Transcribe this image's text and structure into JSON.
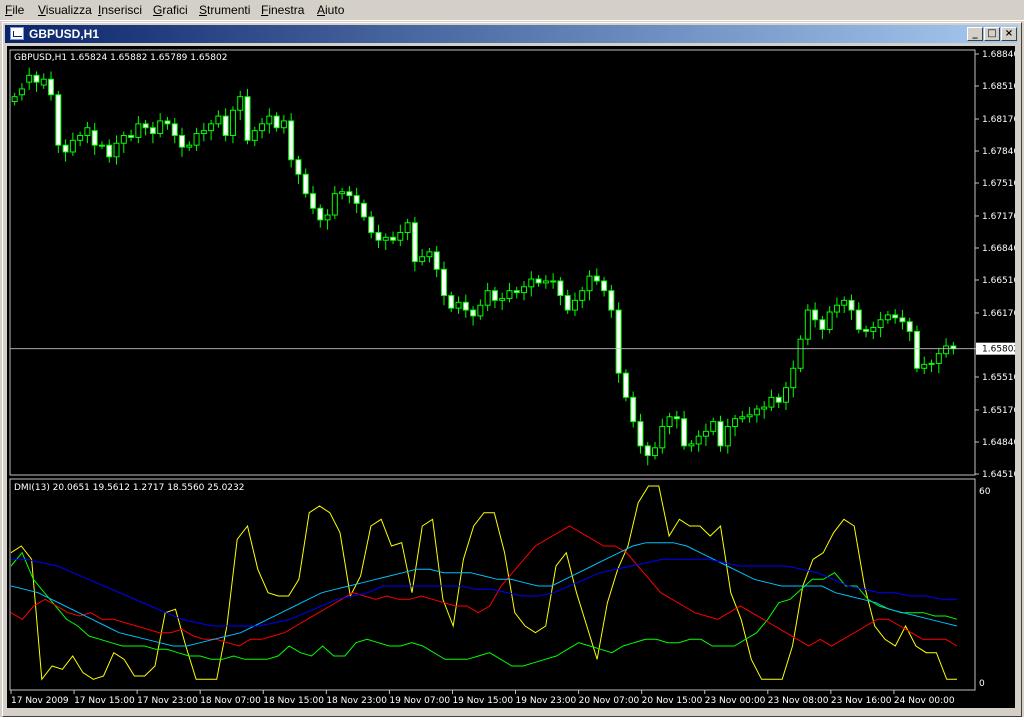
{
  "menu": {
    "items": [
      {
        "underline": "F",
        "rest": "ile"
      },
      {
        "underline": "V",
        "rest": "isualizza"
      },
      {
        "underline": "I",
        "rest": "nserisci"
      },
      {
        "underline": "G",
        "rest": "rafici"
      },
      {
        "underline": "S",
        "rest": "trumenti"
      },
      {
        "underline": "F",
        "rest": "inestra"
      },
      {
        "underline": "A",
        "rest": "iuto"
      }
    ]
  },
  "window": {
    "title": "GBPUSD,H1",
    "buttons": [
      "_",
      "□",
      "×"
    ]
  },
  "chart_data": [
    {
      "type": "candlestick",
      "title": "GBPUSD,H1  1.65824 1.65882 1.65789 1.65802",
      "ylim": [
        1.6451,
        1.6884
      ],
      "y_ticks": [
        "1.68840",
        "1.68510",
        "1.68170",
        "1.67840",
        "1.67510",
        "1.67170",
        "1.66840",
        "1.66510",
        "1.66170",
        "1.65802",
        "1.65510",
        "1.65170",
        "1.64840",
        "1.64510"
      ],
      "current_price": 1.65802,
      "colors": {
        "up": "#000000",
        "down": "#ffffff",
        "wick": "#00ff00",
        "price_line": "#c0c0c0"
      },
      "closes": [
        1.684,
        1.6848,
        1.6862,
        1.6855,
        1.6858,
        1.6842,
        1.679,
        1.6783,
        1.6795,
        1.68,
        1.6808,
        1.679,
        1.679,
        1.6778,
        1.6792,
        1.68,
        1.6798,
        1.6812,
        1.6808,
        1.6802,
        1.6815,
        1.6812,
        1.68,
        1.6788,
        1.679,
        1.6802,
        1.6805,
        1.6812,
        1.682,
        1.68,
        1.6826,
        1.684,
        1.6795,
        1.6805,
        1.6812,
        1.682,
        1.6808,
        1.6815,
        1.6775,
        1.676,
        1.674,
        1.6725,
        1.6713,
        1.6718,
        1.674,
        1.6742,
        1.6738,
        1.673,
        1.6716,
        1.67,
        1.6692,
        1.6695,
        1.6692,
        1.67,
        1.671,
        1.667,
        1.6675,
        1.668,
        1.6662,
        1.6635,
        1.6622,
        1.6628,
        1.662,
        1.6614,
        1.6625,
        1.664,
        1.663,
        1.6632,
        1.664,
        1.6638,
        1.6644,
        1.6652,
        1.6648,
        1.665,
        1.665,
        1.6635,
        1.662,
        1.663,
        1.664,
        1.6655,
        1.665,
        1.664,
        1.662,
        1.6555,
        1.653,
        1.6505,
        1.648,
        1.647,
        1.6478,
        1.65,
        1.651,
        1.6508,
        1.648,
        1.6482,
        1.649,
        1.6495,
        1.6505,
        1.648,
        1.65,
        1.6508,
        1.651,
        1.6512,
        1.6518,
        1.652,
        1.653,
        1.6525,
        1.654,
        1.656,
        1.659,
        1.662,
        1.661,
        1.66,
        1.6618,
        1.6625,
        1.663,
        1.662,
        1.66,
        1.6598,
        1.6602,
        1.661,
        1.6615,
        1.6612,
        1.6608,
        1.6598,
        1.656,
        1.6564,
        1.6565,
        1.6575,
        1.6583,
        1.65802
      ],
      "opens": [
        1.6835,
        1.6842,
        1.6855,
        1.6862,
        1.6852,
        1.6858,
        1.6842,
        1.679,
        1.6783,
        1.6795,
        1.68,
        1.6805,
        1.679,
        1.679,
        1.6778,
        1.6792,
        1.68,
        1.6798,
        1.6812,
        1.6808,
        1.6802,
        1.6815,
        1.6812,
        1.68,
        1.6788,
        1.679,
        1.6802,
        1.6805,
        1.6812,
        1.682,
        1.68,
        1.6826,
        1.684,
        1.6795,
        1.6805,
        1.6812,
        1.682,
        1.6808,
        1.6815,
        1.6775,
        1.676,
        1.674,
        1.6725,
        1.6713,
        1.6718,
        1.674,
        1.6742,
        1.6738,
        1.673,
        1.6716,
        1.67,
        1.6692,
        1.6695,
        1.6692,
        1.67,
        1.671,
        1.667,
        1.6675,
        1.668,
        1.6662,
        1.6635,
        1.6622,
        1.6628,
        1.662,
        1.6614,
        1.6625,
        1.664,
        1.663,
        1.6632,
        1.664,
        1.6638,
        1.6644,
        1.6652,
        1.6648,
        1.665,
        1.665,
        1.6635,
        1.662,
        1.663,
        1.664,
        1.6655,
        1.665,
        1.664,
        1.662,
        1.6555,
        1.653,
        1.6505,
        1.648,
        1.647,
        1.6478,
        1.65,
        1.651,
        1.6508,
        1.648,
        1.6482,
        1.649,
        1.6495,
        1.6505,
        1.648,
        1.65,
        1.6508,
        1.651,
        1.6512,
        1.6518,
        1.652,
        1.653,
        1.6525,
        1.654,
        1.656,
        1.659,
        1.662,
        1.661,
        1.66,
        1.6618,
        1.6625,
        1.663,
        1.662,
        1.66,
        1.6598,
        1.6602,
        1.661,
        1.6615,
        1.6612,
        1.6608,
        1.6598,
        1.656,
        1.6564,
        1.6565,
        1.6575,
        1.6583
      ]
    },
    {
      "type": "line",
      "title": "DMI(13) 20.0651 19.5612 1.2717 18.5560 25.0232",
      "ylim": [
        0,
        60
      ],
      "y_ticks": [
        "60",
        "0"
      ],
      "x_labels": [
        "17 Nov 2009",
        "17 Nov 15:00",
        "17 Nov 23:00",
        "18 Nov 07:00",
        "18 Nov 15:00",
        "18 Nov 23:00",
        "19 Nov 07:00",
        "19 Nov 15:00",
        "19 Nov 23:00",
        "20 Nov 07:00",
        "20 Nov 15:00",
        "23 Nov 00:00",
        "23 Nov 08:00",
        "23 Nov 16:00",
        "24 Nov 00:00"
      ],
      "series": [
        {
          "color": "#ffff00",
          "values": [
            40,
            42,
            38,
            2,
            6,
            5,
            9,
            4,
            2,
            3,
            10,
            8,
            3,
            3,
            6,
            22,
            23,
            12,
            2,
            2,
            2,
            18,
            44,
            48,
            35,
            28,
            27,
            27,
            32,
            52,
            54,
            52,
            46,
            27,
            33,
            48,
            50,
            42,
            43,
            28,
            48,
            50,
            26,
            18,
            38,
            48,
            52,
            52,
            40,
            22,
            18,
            16,
            18,
            36,
            40,
            28,
            18,
            8,
            25,
            35,
            42,
            55,
            60,
            60,
            45,
            50,
            48,
            48,
            45,
            48,
            28,
            20,
            8,
            2,
            2,
            2,
            12,
            30,
            38,
            40,
            46,
            50,
            48,
            30,
            18,
            14,
            12,
            18,
            12,
            10,
            10,
            2,
            2
          ]
        },
        {
          "color": "#00ff00",
          "values": [
            36,
            40,
            32,
            28,
            24,
            20,
            18,
            15,
            14,
            13,
            12,
            12,
            12,
            11,
            11,
            10,
            9,
            9,
            8,
            8,
            9,
            8,
            8,
            8,
            9,
            12,
            10,
            9,
            12,
            9,
            9,
            13,
            14,
            13,
            12,
            12,
            13,
            12,
            10,
            8,
            8,
            8,
            9,
            10,
            8,
            6,
            6,
            7,
            8,
            9,
            11,
            13,
            12,
            11,
            10,
            12,
            13,
            14,
            14,
            13,
            13,
            14,
            14,
            12,
            12,
            12,
            14,
            16,
            20,
            25,
            26,
            29,
            32,
            32,
            34,
            30,
            30,
            26,
            24,
            23,
            22,
            22,
            22,
            21,
            21,
            20
          ]
        },
        {
          "color": "#ff0000",
          "values": [
            22,
            20,
            24,
            26,
            24,
            22,
            21,
            22,
            20,
            20,
            19,
            18,
            17,
            16,
            16,
            17,
            15,
            14,
            14,
            13,
            12,
            14,
            14,
            15,
            16,
            18,
            20,
            22,
            24,
            26,
            28,
            27,
            26,
            27,
            26,
            26,
            27,
            26,
            25,
            24,
            24,
            22,
            24,
            30,
            34,
            38,
            42,
            44,
            46,
            48,
            46,
            44,
            42,
            42,
            40,
            36,
            32,
            28,
            26,
            24,
            22,
            21,
            20,
            22,
            24,
            22,
            20,
            18,
            16,
            14,
            12,
            14,
            12,
            14,
            16,
            18,
            20,
            20,
            18,
            16,
            14,
            14,
            14,
            12
          ]
        },
        {
          "color": "#00bfff",
          "values": [
            30,
            29,
            28,
            26,
            24,
            22,
            20,
            18,
            16,
            15,
            14,
            13,
            12,
            12,
            13,
            14,
            15,
            16,
            18,
            20,
            22,
            24,
            26,
            28,
            29,
            30,
            31,
            32,
            33,
            34,
            35,
            35,
            34,
            34,
            34,
            33,
            32,
            32,
            31,
            30,
            30,
            32,
            34,
            36,
            38,
            40,
            42,
            43,
            43,
            43,
            42,
            40,
            38,
            36,
            34,
            32,
            31,
            30,
            30,
            30,
            30,
            28,
            27,
            26,
            25,
            23,
            22,
            21,
            20,
            19,
            18
          ]
        },
        {
          "color": "#0000ff",
          "values": [
            38,
            38,
            37,
            36,
            34,
            32,
            30,
            28,
            26,
            24,
            22,
            20,
            19,
            18,
            18,
            18,
            18,
            19,
            20,
            22,
            24,
            26,
            27,
            28,
            30,
            30,
            30,
            30,
            30,
            30,
            29,
            29,
            28,
            27,
            27,
            28,
            30,
            32,
            34,
            35,
            36,
            37,
            38,
            38,
            38,
            38,
            37,
            36,
            36,
            36,
            36,
            35,
            34,
            32,
            30,
            29,
            28,
            28,
            27,
            27,
            26,
            26
          ]
        }
      ]
    }
  ]
}
